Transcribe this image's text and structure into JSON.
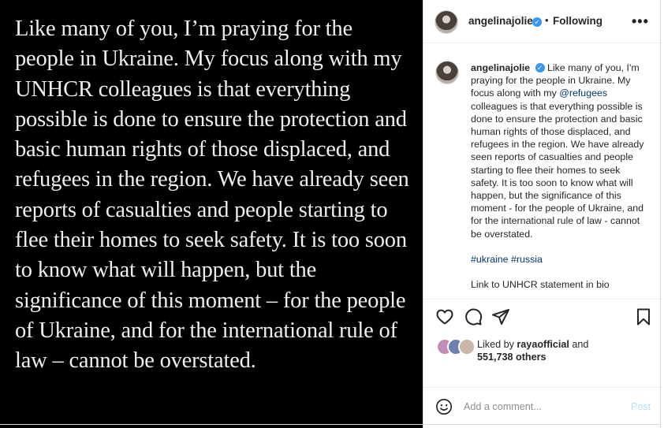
{
  "post_image": {
    "text": "Like many of you, I’m praying for the people in Ukraine. My focus along with my UNHCR colleagues is that everything possible is done to ensure the protection and basic human rights of those displaced, and refugees in the region. We have already seen reports of casualties and people starting to flee their homes to seek safety. It is too soon to know what will happen, but the significance of this moment – for the people of Ukraine, and for the international rule of law – cannot be overstated."
  },
  "header": {
    "username": "angelinajolie",
    "verified_mark": "✓",
    "separator": "•",
    "follow_label": "Following",
    "more_label": "•••"
  },
  "caption": {
    "username": "angelinajolie",
    "verified_mark": "✓",
    "text_before_mention": "Like many of you, I'm praying for the people in Ukraine. My focus along with my ",
    "mention": "@refugees",
    "text_after_mention": " colleagues is that everything possible is done to ensure the protection and basic human rights of those displaced, and refugees in the region. We have already seen reports of casualties and people starting to flee their homes to seek safety. It is too soon to know what will happen, but the significance of this moment - for the people of Ukraine, and for the international rule of law - cannot be overstated.",
    "hashtag_1": "#ukraine",
    "hashtag_2": "#russia",
    "footer_line": "Link to UNHCR statement in bio"
  },
  "actions": {
    "icons": [
      "heart-icon",
      "comment-icon",
      "share-icon",
      "bookmark-icon"
    ]
  },
  "likes": {
    "prefix": "Liked by ",
    "liker": "rayaofficial",
    "middle": " and",
    "count_text": "551,738 others"
  },
  "comment": {
    "placeholder": "Add a comment...",
    "post_label": "Post"
  },
  "colors": {
    "image_bg": "#000000",
    "verified_blue": "#3897f0",
    "link_color": "#00376b",
    "post_disabled": "#b2dffc"
  }
}
